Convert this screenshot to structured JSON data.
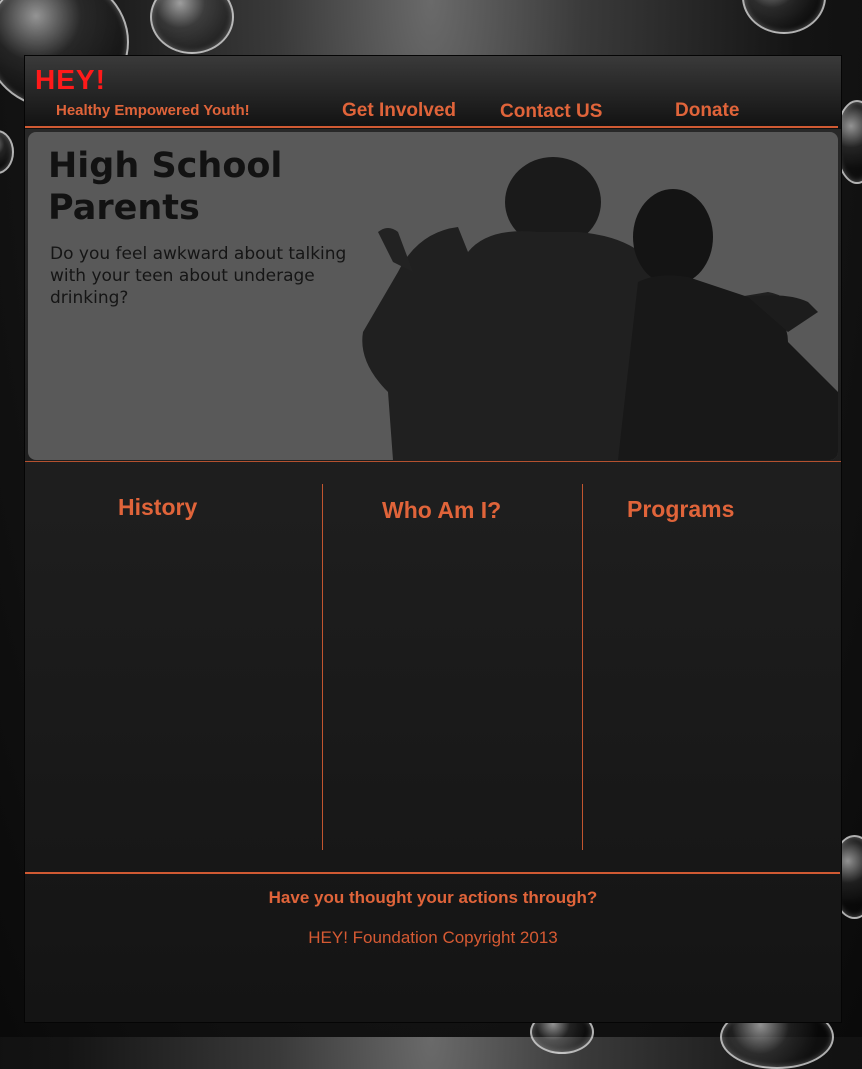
{
  "site": {
    "logo": "HEY!",
    "tagline": "Healthy Empowered Youth!"
  },
  "nav": {
    "items": [
      "Get Involved",
      "Contact US",
      "Donate"
    ]
  },
  "hero": {
    "title": "High School Parents",
    "text": "Do you feel awkward about talking with your teen about underage drinking?"
  },
  "columns": [
    "History",
    "Who Am I?",
    "Programs"
  ],
  "footer": {
    "question": "Have you thought your actions through?",
    "copyright": "HEY! Foundation Copyright 2013"
  },
  "colors": {
    "accent": "#e0643a",
    "logo": "#ff1a1a"
  }
}
